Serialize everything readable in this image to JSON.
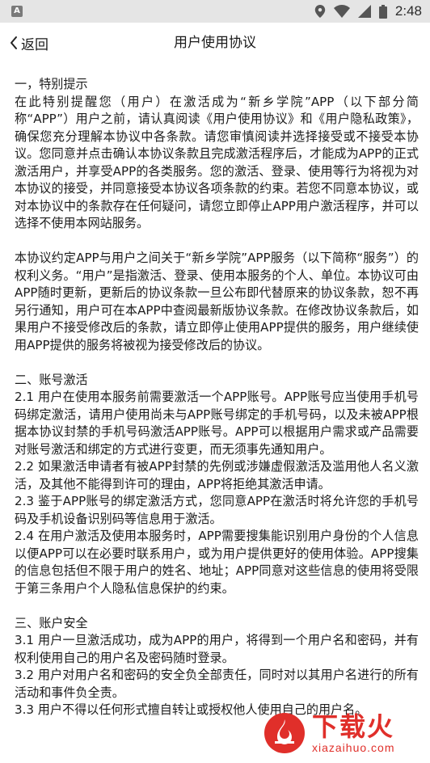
{
  "status_bar": {
    "time": "2:48",
    "app_badge": "A",
    "icons": [
      "location-icon",
      "wifi-icon",
      "signal-icon",
      "battery-icon"
    ]
  },
  "nav": {
    "back_label": "返回",
    "title": "用户使用协议"
  },
  "content": {
    "paragraphs": [
      "一，特别提示",
      "在此特别提醒您（用户）在激活成为“新乡学院”APP（以下部分简称“APP”）用户之前，请认真阅读《用户使用协议》和《用户隐私政策》，确保您充分理解本协议中各条款。请您审慎阅读并选择接受或不接受本协议。您同意并点击确认本协议条款且完成激活程序后，才能成为APP的正式激活用户，并享受APP的各类服务。您的激活、登录、使用等行为将视为对本协议的接受，并同意接受本协议各项条款的约束。若您不同意本协议，或对本协议中的条款存在任何疑问，请您立即停止APP用户激活程序，并可以选择不使用本网站服务。",
      "",
      "本协议约定APP与用户之间关于“新乡学院”APP服务（以下简称“服务”）的权利义务。“用户”是指激活、登录、使用本服务的个人、单位。本协议可由APP随时更新，更新后的协议条款一旦公布即代替原来的协议条款，恕不再另行通知，用户可在本APP中查阅最新版协议条款。在修改协议条款后，如果用户不接受修改后的条款，请立即停止使用APP提供的服务，用户继续使用APP提供的服务将被视为接受修改后的协议。",
      "",
      "二、账号激活",
      "2.1 用户在使用本服务前需要激活一个APP账号。APP账号应当使用手机号码绑定激活，请用户使用尚未与APP账号绑定的手机号码，以及未被APP根据本协议封禁的手机号码激活APP账号。APP可以根据用户需求或产品需要对账号激活和绑定的方式进行变更，而无须事先通知用户。",
      "2.2 如果激活申请者有被APP封禁的先例或涉嫌虚假激活及滥用他人名义激活，及其他不能得到许可的理由，APP将拒绝其激活申请。",
      "2.3 鉴于APP账号的绑定激活方式，您同意APP在激活时将允许您的手机号码及手机设备识别码等信息用于激活。",
      "2.4 在用户激活及使用本服务时，APP需要搜集能识别用户身份的个人信息以便APP可以在必要时联系用户，或为用户提供更好的使用体验。APP搜集的信息包括但不限于用户的姓名、地址；APP同意对这些信息的使用将受限于第三条用户个人隐私信息保护的约束。",
      "",
      "三、账户安全",
      "3.1 用户一旦激活成功，成为APP的用户，将得到一个用户名和密码，并有权利使用自己的用户名及密码随时登录。",
      "3.2 用户对用户名和密码的安全负全部责任，同时对以其用户名进行的所有活动和事件负全责。",
      "3.3 用户不得以任何形式擅自转让或授权他人使用自己的用户名。"
    ]
  },
  "watermark": {
    "main": "下载火",
    "sub": "xiazaihuo.com"
  },
  "colors": {
    "status_bar_bg": "#e5e5e5",
    "watermark_red": "#e02f2a"
  }
}
